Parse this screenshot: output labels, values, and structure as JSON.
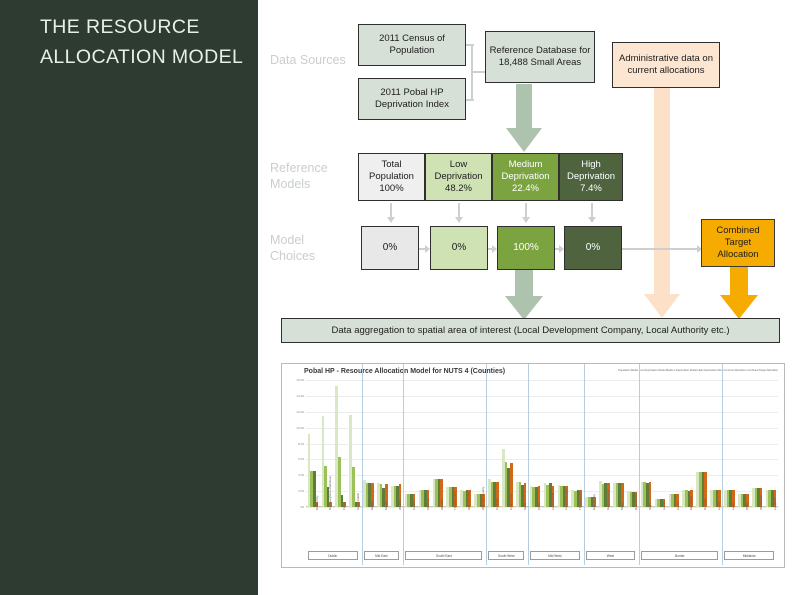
{
  "slide": {
    "title": "THE RESOURCE ALLOCATION MODEL",
    "background": "#ffffff",
    "sidebar_color": "#2e3b31",
    "title_color": "#e7efe6"
  },
  "rows": {
    "data_sources_label": "Data Sources",
    "reference_models_label": "Reference Models",
    "model_choices_label": "Model Choices"
  },
  "data_sources": {
    "sources": [
      {
        "label": "2011 Census of Population",
        "color": "#d7e0d6"
      },
      {
        "label": "2011 Pobal HP Deprivation Index",
        "color": "#d7e0d6"
      }
    ],
    "reference_database": {
      "label": "Reference Database for 18,488 Small Areas",
      "color": "#d7e0d6"
    },
    "administrative": {
      "label": "Administrative data on current allocations",
      "color": "#fce6d2"
    }
  },
  "reference_models": [
    {
      "name": "Total Population",
      "value": "100%",
      "color": "#efefef"
    },
    {
      "name": "Low Deprivation",
      "value": "48.2%",
      "color": "#cfe2b4"
    },
    {
      "name": "Medium Deprivation",
      "value": "22.4%",
      "color": "#7ba441"
    },
    {
      "name": "High Deprivation",
      "value": "7.4%",
      "color": "#4f633e"
    }
  ],
  "model_choices": [
    {
      "value": "0%",
      "color": "#e8e8e8"
    },
    {
      "value": "0%",
      "color": "#cfe2b4"
    },
    {
      "value": "100%",
      "color": "#7ba441"
    },
    {
      "value": "0%",
      "color": "#4f633e"
    }
  ],
  "combined_target": {
    "label": "Combined Target Allocation",
    "color": "#f5ab00"
  },
  "aggregation": {
    "label": "Data aggregation to spatial area of interest (Local Development Company, Local Authority etc.)",
    "color": "#d7e0d6"
  },
  "arrows": {
    "sage": "#aec3ae",
    "peach": "#fce0c8",
    "gold": "#f5ab00",
    "grey": "#cfcfcf"
  },
  "chart_data": {
    "type": "bar",
    "title": "Pobal HP - Resource Allocation Model for NUTS 4 (Counties)",
    "legend": "Population Model   Low Deprivation Model   Medium Deprivation Model   High Deprivation Model   Current Allocation   Combined Target Allocation",
    "legend_position": "top-right",
    "xlabel": "",
    "ylabel": "",
    "ylim": [
      0,
      16
    ],
    "yticks": [
      "16.00",
      "14.00",
      "12.00",
      "10.00",
      "8.00",
      "6.00",
      "4.00",
      "2.00",
      ".00"
    ],
    "grid": true,
    "series": [
      {
        "name": "Population Model",
        "color": "#d9e8c2"
      },
      {
        "name": "Medium Deprivation Model",
        "color": "#9cc05a"
      },
      {
        "name": "High Deprivation Model",
        "color": "#5f7c38"
      },
      {
        "name": "Combined Target Allocation",
        "color": "#d2691a"
      }
    ],
    "regions": [
      {
        "name": "Dublin",
        "categories": [
          "Dublin City",
          "Dun Laoghaire-Rathdown",
          "Fingal",
          "South Dublin"
        ],
        "values": [
          [
            9.2,
            11.5,
            15.2,
            11.6
          ],
          [
            4.6,
            5.2,
            6.3,
            5.0
          ],
          [
            4.6,
            2.5,
            1.5,
            0.6
          ],
          [
            0.6,
            0.6,
            0.6,
            0.6
          ]
        ]
      },
      {
        "name": "Mid East",
        "categories": [
          "Kildare",
          "Meath",
          "Wicklow"
        ],
        "values": [
          [
            3.4,
            3.0,
            2.6
          ],
          [
            3.0,
            2.9,
            2.6
          ],
          [
            3.0,
            2.4,
            2.6
          ],
          [
            3.0,
            2.9,
            2.9
          ]
        ]
      },
      {
        "name": "South East",
        "categories": [
          "Carlow",
          "Kilkenny",
          "Wexford",
          "Tipperary S.R.",
          "Waterford City",
          "Waterford County"
        ],
        "values": [
          [
            1.7,
            2.2,
            3.5,
            2.5,
            2.2,
            1.6
          ],
          [
            1.7,
            2.1,
            3.5,
            2.5,
            2.0,
            1.6
          ],
          [
            1.7,
            2.2,
            3.5,
            2.5,
            2.2,
            1.6
          ],
          [
            1.7,
            2.2,
            3.5,
            2.5,
            2.2,
            1.6
          ]
        ]
      },
      {
        "name": "South West",
        "categories": [
          "Cork City",
          "Cork County",
          "Kerry"
        ],
        "values": [
          [
            3.5,
            7.3,
            3.2
          ],
          [
            3.1,
            5.7,
            3.1
          ],
          [
            3.1,
            4.9,
            2.8
          ],
          [
            3.1,
            5.6,
            3.0
          ]
        ]
      },
      {
        "name": "Mid West",
        "categories": [
          "Clare",
          "Limerick City",
          "Limerick County",
          "Tipperary N.R."
        ],
        "values": [
          [
            2.7,
            3.0,
            2.8,
            2.2
          ],
          [
            2.5,
            2.8,
            2.6,
            2.0
          ],
          [
            2.5,
            3.0,
            2.7,
            2.1
          ],
          [
            2.6,
            2.7,
            2.6,
            2.1
          ]
        ]
      },
      {
        "name": "West",
        "categories": [
          "Galway City",
          "Galway County",
          "Mayo",
          "Roscommon"
        ],
        "values": [
          [
            1.3,
            3.3,
            3.0,
            2.0
          ],
          [
            1.2,
            2.9,
            3.0,
            1.9
          ],
          [
            1.2,
            3.0,
            3.0,
            1.9
          ],
          [
            1.2,
            3.0,
            3.0,
            1.9
          ]
        ]
      },
      {
        "name": "Border",
        "categories": [
          "Sligo",
          "Leitrim",
          "Cavan",
          "Monaghan",
          "Donegal",
          "Louth"
        ],
        "values": [
          [
            3.2,
            1.0,
            1.6,
            2.1,
            4.4,
            2.2
          ],
          [
            3.1,
            1.0,
            1.6,
            2.1,
            4.4,
            2.1
          ],
          [
            3.0,
            1.0,
            1.6,
            2.0,
            4.4,
            2.1
          ],
          [
            3.1,
            1.0,
            1.6,
            2.1,
            4.4,
            2.1
          ]
        ]
      },
      {
        "name": "Midlands",
        "categories": [
          "Laois",
          "Offaly",
          "Westmeath",
          "Longford"
        ],
        "values": [
          [
            2.1,
            1.6,
            2.4,
            2.1
          ],
          [
            2.1,
            1.6,
            2.4,
            2.1
          ],
          [
            2.1,
            1.6,
            2.4,
            2.1
          ],
          [
            2.1,
            1.6,
            2.4,
            2.1
          ]
        ]
      }
    ]
  }
}
